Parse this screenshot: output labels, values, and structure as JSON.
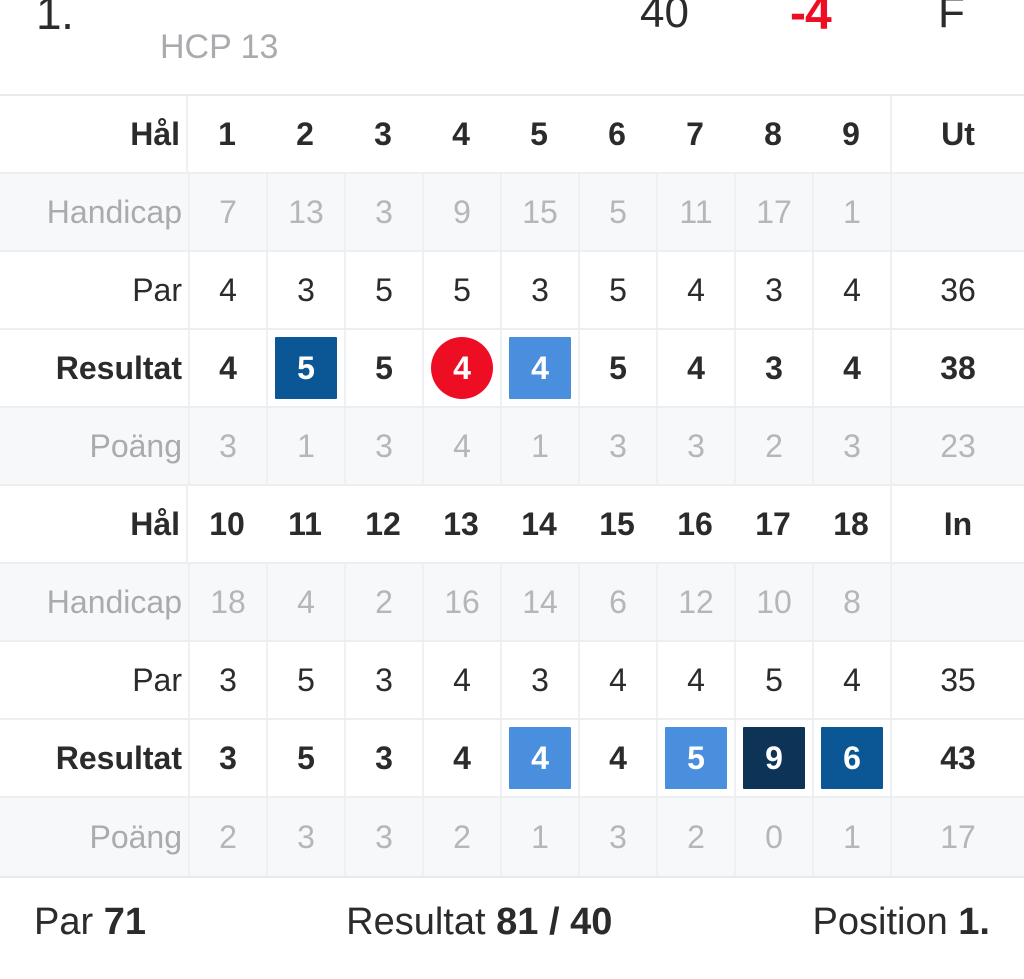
{
  "header": {
    "position": "1.",
    "hcp": "HCP 13",
    "points": "40",
    "to_par": "-4",
    "status": "F",
    "to_par_color": "#ee0e23"
  },
  "labels": {
    "hole": "Hål",
    "handicap": "Handicap",
    "par": "Par",
    "result": "Resultat",
    "points": "Poäng",
    "out": "Ut",
    "in": "In"
  },
  "colors": {
    "eagle_or_better": "#0d3356",
    "birdie": "#0b5694",
    "par_circle": "#ee0e23",
    "bogey": "#4a8fdd",
    "text": "#2b2b2b",
    "muted": "#b4b6b9"
  },
  "front": {
    "holes": [
      "1",
      "2",
      "3",
      "4",
      "5",
      "6",
      "7",
      "8",
      "9"
    ],
    "handicap": [
      "7",
      "13",
      "3",
      "9",
      "15",
      "5",
      "11",
      "17",
      "1"
    ],
    "handicap_total": "",
    "par": [
      "4",
      "3",
      "5",
      "5",
      "3",
      "5",
      "4",
      "3",
      "4"
    ],
    "par_total": "36",
    "result": [
      {
        "value": "4",
        "style": "plain"
      },
      {
        "value": "5",
        "style": "square-dark"
      },
      {
        "value": "5",
        "style": "plain"
      },
      {
        "value": "4",
        "style": "circle-red"
      },
      {
        "value": "4",
        "style": "square-light"
      },
      {
        "value": "5",
        "style": "plain"
      },
      {
        "value": "4",
        "style": "plain"
      },
      {
        "value": "3",
        "style": "plain"
      },
      {
        "value": "4",
        "style": "plain"
      }
    ],
    "result_total": "38",
    "points": [
      "3",
      "1",
      "3",
      "4",
      "1",
      "3",
      "3",
      "2",
      "3"
    ],
    "points_total": "23",
    "total_label": "Ut"
  },
  "back": {
    "holes": [
      "10",
      "11",
      "12",
      "13",
      "14",
      "15",
      "16",
      "17",
      "18"
    ],
    "handicap": [
      "18",
      "4",
      "2",
      "16",
      "14",
      "6",
      "12",
      "10",
      "8"
    ],
    "handicap_total": "",
    "par": [
      "3",
      "5",
      "3",
      "4",
      "3",
      "4",
      "4",
      "5",
      "4"
    ],
    "par_total": "35",
    "result": [
      {
        "value": "3",
        "style": "plain"
      },
      {
        "value": "5",
        "style": "plain"
      },
      {
        "value": "3",
        "style": "plain"
      },
      {
        "value": "4",
        "style": "plain"
      },
      {
        "value": "4",
        "style": "square-light"
      },
      {
        "value": "4",
        "style": "plain"
      },
      {
        "value": "5",
        "style": "square-light"
      },
      {
        "value": "9",
        "style": "square-navy"
      },
      {
        "value": "6",
        "style": "square-dark"
      }
    ],
    "result_total": "43",
    "points": [
      "2",
      "3",
      "3",
      "2",
      "1",
      "3",
      "2",
      "0",
      "1"
    ],
    "points_total": "17",
    "total_label": "In"
  },
  "footer": {
    "par_label": "Par",
    "par_value": "71",
    "result_label": "Resultat",
    "result_value": "81 / 40",
    "position_label": "Position",
    "position_value": "1."
  }
}
